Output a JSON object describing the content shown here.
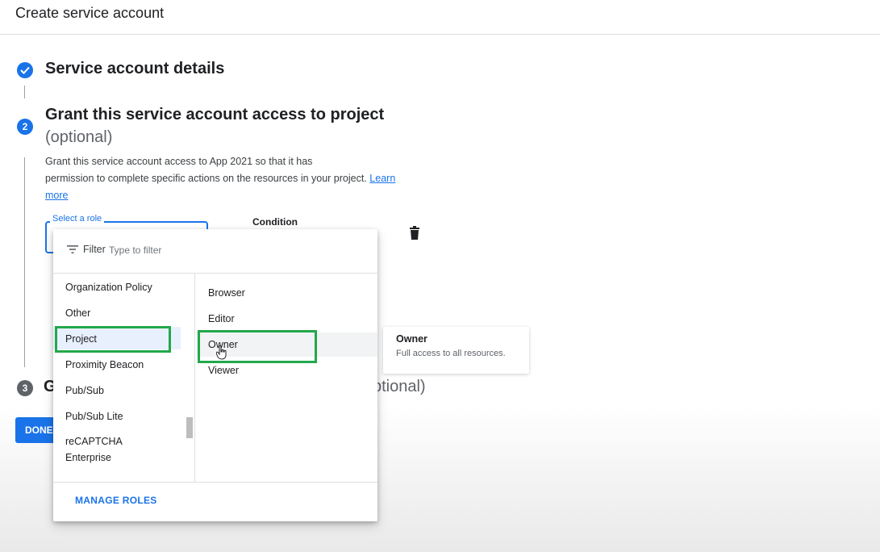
{
  "header": {
    "title": "Create service account"
  },
  "steps": {
    "step1": {
      "title": "Service account details"
    },
    "step2": {
      "number": "2",
      "title": "Grant this service account access to project",
      "optional": "(optional)",
      "description_line1": "Grant this service account access to App  2021 so that it has",
      "description_line2": "permission to complete specific actions on the resources in your project.",
      "learn": "Learn",
      "more": "more"
    },
    "step3": {
      "number": "3",
      "title_visible": "G",
      "optional_visible": "ptional)"
    }
  },
  "role_field": {
    "label": "Select a role"
  },
  "condition": {
    "label": "Condition"
  },
  "done_button": {
    "label": "DONE"
  },
  "dropdown": {
    "filter_label": "Filter",
    "filter_placeholder": "Type to filter",
    "services": [
      "Organization Policy",
      "Other",
      "Project",
      "Proximity Beacon",
      "Pub/Sub",
      "Pub/Sub Lite",
      "reCAPTCHA",
      "Enterprise"
    ],
    "selected_service": "Project",
    "roles": [
      "Browser",
      "Editor",
      "Owner",
      "Viewer"
    ],
    "hovered_role": "Owner",
    "manage_roles": "MANAGE ROLES"
  },
  "tooltip": {
    "title": "Owner",
    "description": "Full access to all resources."
  },
  "colors": {
    "accent": "#1a73e8",
    "highlight": "#22a84a"
  }
}
